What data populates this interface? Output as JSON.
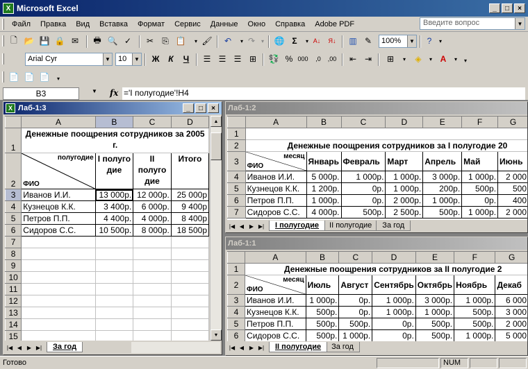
{
  "app": {
    "title": "Microsoft Excel"
  },
  "menu": [
    "Файл",
    "Правка",
    "Вид",
    "Вставка",
    "Формат",
    "Сервис",
    "Данные",
    "Окно",
    "Справка",
    "Adobe PDF"
  ],
  "help_placeholder": "Введите вопрос",
  "toolbar": {
    "zoom": "100%",
    "font": "Arial Cyr",
    "size": "10"
  },
  "formula_bar": {
    "cell": "B3",
    "fx": "fx",
    "formula": "='I полугодие'!H4"
  },
  "status": {
    "text": "Готово",
    "num": "NUM"
  },
  "win1": {
    "title": "Лаб-1:3",
    "cols": [
      "A",
      "B",
      "C",
      "D"
    ],
    "title_text": "Денежные поощрения сотрудников за 2005 г.",
    "hdr_top": "полугодие",
    "hdr_bot": "ФИО",
    "hdr_b": "I полуго дие",
    "hdr_c": "II полуго дие",
    "hdr_d": "Итого",
    "rows": [
      [
        "3",
        "Иванов И.И.",
        "13 000р.",
        "12 000р.",
        "25 000р"
      ],
      [
        "4",
        "Кузнецов К.К.",
        "3 400р.",
        "6 000р.",
        "9 400р"
      ],
      [
        "5",
        "Петров П.П.",
        "4 400р.",
        "4 000р.",
        "8 400р"
      ],
      [
        "6",
        "Сидоров С.С.",
        "10 500р.",
        "8 000р.",
        "18 500р"
      ]
    ],
    "empty_rows": [
      "7",
      "8",
      "9",
      "10",
      "11",
      "12",
      "13",
      "14",
      "15"
    ],
    "tabs": [
      "За год"
    ]
  },
  "win2": {
    "title": "Лаб-1:2",
    "cols": [
      "A",
      "B",
      "C",
      "D",
      "E",
      "F",
      "G"
    ],
    "title_text": "Денежные поощрения сотрудников за I полугодие 20",
    "hdr_top": "месяц",
    "hdr_bot": "ФИО",
    "months": [
      "Январь",
      "Февраль",
      "Март",
      "Апрель",
      "Май",
      "Июнь"
    ],
    "rows": [
      [
        "4",
        "Иванов И.И.",
        "5 000р.",
        "1 000р.",
        "1 000р.",
        "3 000р.",
        "1 000р.",
        "2 000"
      ],
      [
        "5",
        "Кузнецов К.К.",
        "1 200р.",
        "0р.",
        "1 000р.",
        "200р.",
        "500р.",
        "500"
      ],
      [
        "6",
        "Петров П.П.",
        "1 000р.",
        "0р.",
        "2 000р.",
        "1 000р.",
        "0р.",
        "400"
      ],
      [
        "7",
        "Сидоров С.С.",
        "4 000р.",
        "500р.",
        "2 500р.",
        "500р.",
        "1 000р.",
        "2 000"
      ]
    ],
    "tabs": [
      "I полугодие",
      "II полугодие",
      "За год"
    ]
  },
  "win3": {
    "title": "Лаб-1:1",
    "cols": [
      "A",
      "B",
      "C",
      "D",
      "E",
      "F",
      "G"
    ],
    "title_text": "Денежные поощрения сотрудников за II полугодие 2",
    "hdr_top": "месяц",
    "hdr_bot": "ФИО",
    "months": [
      "Июль",
      "Август",
      "Сентябрь",
      "Октябрь",
      "Ноябрь",
      "Декаб"
    ],
    "rows": [
      [
        "3",
        "Иванов И.И.",
        "1 000р.",
        "0р.",
        "1 000р.",
        "3 000р.",
        "1 000р.",
        "6 000"
      ],
      [
        "4",
        "Кузнецов К.К.",
        "500р.",
        "0р.",
        "1 000р.",
        "1 000р.",
        "500р.",
        "3 000"
      ],
      [
        "5",
        "Петров П.П.",
        "500р.",
        "500р.",
        "0р.",
        "500р.",
        "500р.",
        "2 000"
      ],
      [
        "6",
        "Сидоров С.С.",
        "500р.",
        "1 000р.",
        "0р.",
        "500р.",
        "1 000р.",
        "5 000"
      ]
    ],
    "tabs": [
      "II полугодие",
      "За год"
    ]
  }
}
